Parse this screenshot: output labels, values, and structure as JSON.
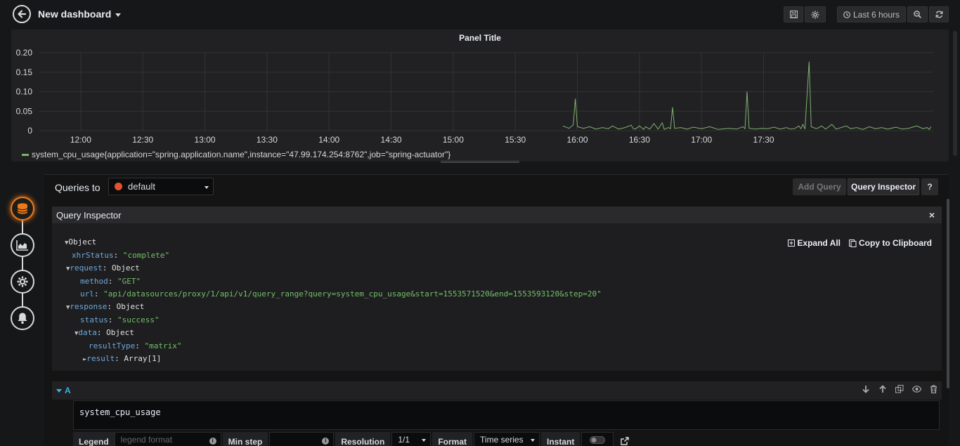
{
  "topnav": {
    "title": "New dashboard",
    "time_range": "Last 6 hours",
    "icons": [
      "back-icon",
      "save-icon",
      "gear-icon",
      "clock-icon",
      "zoom-out-icon",
      "refresh-icon"
    ]
  },
  "panel": {
    "title": "Panel Title",
    "legend": "system_cpu_usage{application=\"spring.application.name\",instance=\"47.99.174.254:8762\",job=\"spring-actuator\"}"
  },
  "chart_data": {
    "type": "line",
    "title": "Panel Title",
    "x_ticks": [
      "12:00",
      "12:30",
      "13:00",
      "13:30",
      "14:00",
      "14:30",
      "15:00",
      "15:30",
      "16:00",
      "16:30",
      "17:00",
      "17:30"
    ],
    "y_ticks": [
      "0.20",
      "0.15",
      "0.10",
      "0.05",
      "0"
    ],
    "ylim": [
      0,
      0.2
    ],
    "grid": true,
    "legend_placement": "bottom-left",
    "colors": {
      "series": "#7eb26d"
    },
    "series": [
      {
        "name": "system_cpu_usage{application=\"spring.application.name\",instance=\"47.99.174.254:8762\",job=\"spring-actuator\"}",
        "points": [
          [
            "15:53",
            0.012
          ],
          [
            "15:56",
            0.006
          ],
          [
            "15:58",
            0.015
          ],
          [
            "15:59",
            0.082
          ],
          [
            "16:00",
            0.01
          ],
          [
            "16:03",
            0.006
          ],
          [
            "16:06",
            0.01
          ],
          [
            "16:09",
            0.004
          ],
          [
            "16:12",
            0.008
          ],
          [
            "16:15",
            0.005
          ],
          [
            "16:17",
            0.012
          ],
          [
            "16:20",
            0.004
          ],
          [
            "16:23",
            0.008
          ],
          [
            "16:26",
            0.014
          ],
          [
            "16:27",
            0.005
          ],
          [
            "16:28",
            0.004
          ],
          [
            "16:30",
            0.012
          ],
          [
            "16:32",
            0.003
          ],
          [
            "16:33",
            0.01
          ],
          [
            "16:35",
            0.004
          ],
          [
            "16:37",
            0.018
          ],
          [
            "16:39",
            0.004
          ],
          [
            "16:41",
            0.02
          ],
          [
            "16:42",
            0.003
          ],
          [
            "16:44",
            0.008
          ],
          [
            "16:45",
            0.005
          ],
          [
            "16:46",
            0.06
          ],
          [
            "16:47",
            0.006
          ],
          [
            "16:50",
            0.008
          ],
          [
            "16:53",
            0.004
          ],
          [
            "16:56",
            0.009
          ],
          [
            "17:00",
            0.005
          ],
          [
            "17:04",
            0.01
          ],
          [
            "17:08",
            0.003
          ],
          [
            "17:13",
            0.006
          ],
          [
            "17:17",
            0.004
          ],
          [
            "17:20",
            0.01
          ],
          [
            "17:21",
            0.005
          ],
          [
            "17:22",
            0.1
          ],
          [
            "17:23",
            0.006
          ],
          [
            "17:26",
            0.004
          ],
          [
            "17:29",
            0.006
          ],
          [
            "17:32",
            0.005
          ],
          [
            "17:35",
            0.009
          ],
          [
            "17:38",
            0.004
          ],
          [
            "17:41",
            0.008
          ],
          [
            "17:43",
            0.004
          ],
          [
            "17:45",
            0.005
          ],
          [
            "17:47",
            0.012
          ],
          [
            "17:48",
            0.005
          ],
          [
            "17:49",
            0.016
          ],
          [
            "17:50",
            0.004
          ],
          [
            "17:52",
            0.177
          ],
          [
            "17:53",
            0.01
          ],
          [
            "17:55",
            0.006
          ],
          [
            "17:56",
            0.006
          ],
          [
            "17:58",
            0.012
          ],
          [
            "18:00",
            0.004
          ],
          [
            "18:03",
            0.016
          ],
          [
            "18:05",
            0.004
          ],
          [
            "18:10",
            0.012
          ],
          [
            "18:12",
            0.005
          ],
          [
            "18:15",
            0.008
          ],
          [
            "18:18",
            0.003
          ],
          [
            "18:21",
            0.01
          ],
          [
            "18:24",
            0.005
          ],
          [
            "18:27",
            0.008
          ],
          [
            "18:30",
            0.004
          ],
          [
            "18:34",
            0.009
          ],
          [
            "18:37",
            0.004
          ],
          [
            "18:40",
            0.006
          ],
          [
            "18:44",
            0.012
          ],
          [
            "18:47",
            0.005
          ],
          [
            "18:49",
            0.008
          ],
          [
            "18:50",
            0.003
          ],
          [
            "18:51",
            0.01
          ]
        ]
      }
    ]
  },
  "editor": {
    "queries_to_label": "Queries to",
    "datasource": "default",
    "add_query_label": "Add Query",
    "query_inspector_label": "Query Inspector",
    "help_label": "?",
    "inspector": {
      "title": "Query Inspector",
      "close": "×",
      "expand_all": "Expand All",
      "copy_clipboard": "Copy to Clipboard",
      "lines": [
        {
          "indent": 0,
          "toggle": "▼",
          "key": "",
          "val": "Object",
          "str": false
        },
        {
          "indent": 1,
          "toggle": "",
          "key": "xhrStatus",
          "val": "\"complete\"",
          "str": true
        },
        {
          "indent": 1,
          "toggle": "▼",
          "key": "request",
          "val": "Object",
          "str": false
        },
        {
          "indent": 2,
          "toggle": "",
          "key": "method",
          "val": "\"GET\"",
          "str": true
        },
        {
          "indent": 2,
          "toggle": "",
          "key": "url",
          "val": "\"api/datasources/proxy/1/api/v1/query_range?query=system_cpu_usage&start=1553571520&end=1553593120&step=20\"",
          "str": true
        },
        {
          "indent": 1,
          "toggle": "▼",
          "key": "response",
          "val": "Object",
          "str": false
        },
        {
          "indent": 2,
          "toggle": "",
          "key": "status",
          "val": "\"success\"",
          "str": true
        },
        {
          "indent": 2,
          "toggle": "▼",
          "key": "data",
          "val": "Object",
          "str": false
        },
        {
          "indent": 3,
          "toggle": "",
          "key": "resultType",
          "val": "\"matrix\"",
          "str": true
        },
        {
          "indent": 3,
          "toggle": "►",
          "key": "result",
          "val": "Array[1]",
          "str": false
        }
      ]
    },
    "query_row": {
      "ref": "A",
      "expression": "system_cpu_usage",
      "legend_label": "Legend",
      "legend_placeholder": "legend format",
      "min_step_label": "Min step",
      "resolution_label": "Resolution",
      "resolution_value": "1/1",
      "format_label": "Format",
      "format_value": "Time series",
      "instant_label": "Instant"
    }
  },
  "side_nav": [
    "queries-icon",
    "visualization-icon",
    "general-icon",
    "alert-icon"
  ]
}
